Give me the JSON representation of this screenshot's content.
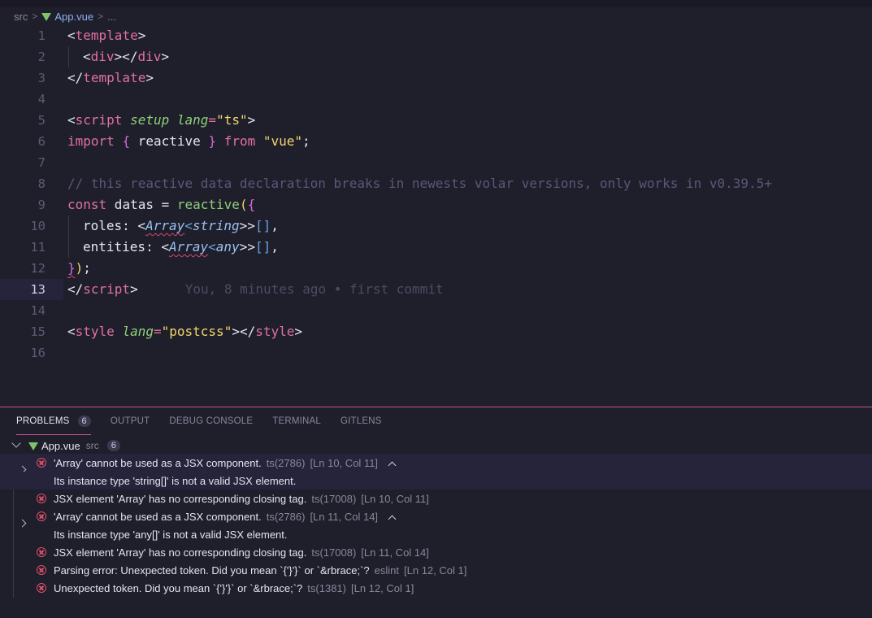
{
  "breadcrumb": {
    "folder": "src",
    "file": "App.vue",
    "more": "..."
  },
  "editor": {
    "lines": [
      {
        "n": "1"
      },
      {
        "n": "2"
      },
      {
        "n": "3"
      },
      {
        "n": "4"
      },
      {
        "n": "5"
      },
      {
        "n": "6"
      },
      {
        "n": "7"
      },
      {
        "n": "8"
      },
      {
        "n": "9"
      },
      {
        "n": "10"
      },
      {
        "n": "11"
      },
      {
        "n": "12"
      },
      {
        "n": "13"
      },
      {
        "n": "14"
      },
      {
        "n": "15"
      },
      {
        "n": "16"
      }
    ],
    "code": {
      "l1": [
        "<",
        "template",
        ">"
      ],
      "l2": [
        "<",
        "div",
        "></",
        "div",
        ">"
      ],
      "l3": [
        "</",
        "template",
        ">"
      ],
      "l5": [
        "<",
        "script",
        " ",
        "setup",
        " ",
        "lang",
        "=",
        "\"ts\"",
        ">"
      ],
      "l6": [
        "import",
        " ",
        " reactive ",
        "}",
        " ",
        "from",
        " ",
        "\"vue\"",
        ";",
        "{"
      ],
      "l8": "// this reactive data declaration breaks in newests volar versions, only works in v0.39.5+",
      "l9": [
        "const",
        " datas = ",
        "reactive",
        "(",
        "{"
      ],
      "l10": [
        "roles: <",
        "Array",
        "<",
        "string",
        ">>",
        "[]",
        ","
      ],
      "l11": [
        "entities: <",
        "Array",
        "<",
        "any",
        ">>",
        "[]",
        ","
      ],
      "l12": [
        "}",
        ")",
        ";"
      ],
      "l13": [
        "</",
        "script",
        ">"
      ],
      "l15": [
        "<",
        "style",
        " ",
        "lang",
        "=",
        "\"postcss\"",
        "></",
        "style",
        ">"
      ]
    },
    "blame": "You, 8 minutes ago • first commit"
  },
  "panel": {
    "tabs": [
      {
        "label": "PROBLEMS",
        "badge": "6"
      },
      {
        "label": "OUTPUT"
      },
      {
        "label": "DEBUG CONSOLE"
      },
      {
        "label": "TERMINAL"
      },
      {
        "label": "GITLENS"
      }
    ],
    "file": {
      "name": "App.vue",
      "folder": "src",
      "count": "6"
    },
    "problems": [
      {
        "msg": "'Array' cannot be used as a JSX component.",
        "source": "ts(2786)",
        "loc": "[Ln 10, Col 11]",
        "detail": "Its instance type 'string[]' is not a valid JSX element."
      },
      {
        "msg": "JSX element 'Array' has no corresponding closing tag.",
        "source": "ts(17008)",
        "loc": "[Ln 10, Col 11]"
      },
      {
        "msg": "'Array' cannot be used as a JSX component.",
        "source": "ts(2786)",
        "loc": "[Ln 11, Col 14]",
        "detail": "Its instance type 'any[]' is not a valid JSX element."
      },
      {
        "msg": "JSX element 'Array' has no corresponding closing tag.",
        "source": "ts(17008)",
        "loc": "[Ln 11, Col 14]"
      },
      {
        "msg": "Parsing error: Unexpected token. Did you mean `{'}'}` or `&rbrace;`?",
        "source": "eslint",
        "loc": "[Ln 12, Col 1]"
      },
      {
        "msg": "Unexpected token. Did you mean `{'}'}` or `&rbrace;`?",
        "source": "ts(1381)",
        "loc": "[Ln 12, Col 1]"
      }
    ]
  },
  "colors": {
    "accent": "#c8508a",
    "error": "#e0506a",
    "background": "#1f1e2b"
  }
}
